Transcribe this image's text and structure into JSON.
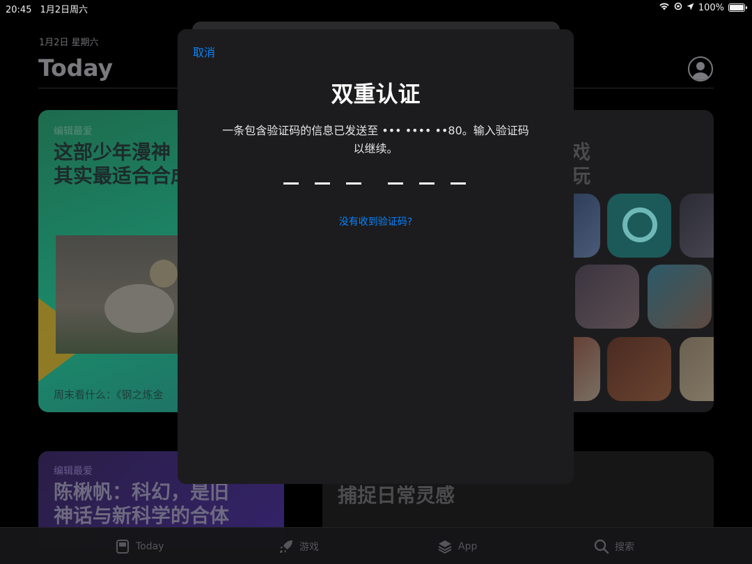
{
  "status_bar": {
    "time": "20:45",
    "date": "1月2日周六",
    "battery": "100%"
  },
  "today_page": {
    "date": "1月2日 星期六",
    "title": "Today",
    "cards": [
      {
        "tag": "编辑最爱",
        "headline_lines": [
          "这部少年漫神",
          "其实最适合合成"
        ],
        "footer": "周末看什么：《钢之炼金"
      },
      {
        "headline_lines": [
          "戏",
          "玩"
        ]
      },
      {
        "tag": "编辑最爱",
        "headline_lines": [
          "陈楸帆：科幻，是旧",
          "神话与新科学的合体"
        ]
      },
      {
        "headline_lines": [
          "捕捉日常灵感"
        ]
      }
    ]
  },
  "tab_bar": {
    "items": [
      {
        "label": "Today",
        "icon": "today-icon"
      },
      {
        "label": "游戏",
        "icon": "rocket-icon"
      },
      {
        "label": "App",
        "icon": "layers-icon"
      },
      {
        "label": "搜索",
        "icon": "search-icon"
      }
    ]
  },
  "modal": {
    "cancel_label": "取消",
    "title": "双重认证",
    "description_line1": "一条包含验证码的信息已发送至 ••• •••• ••80。输入验证码",
    "description_line2": "以继续。",
    "code_length": 6,
    "resend_label": "没有收到验证码?"
  },
  "colors": {
    "accent": "#0a84ff",
    "sheet_background": "#1c1c1e",
    "page_background": "#000000"
  }
}
